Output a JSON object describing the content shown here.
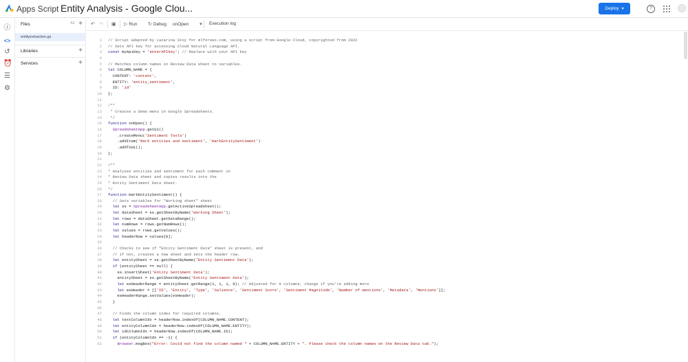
{
  "header": {
    "app_name": "Apps Script",
    "project_title": "Entity Analysis - Google Clou...",
    "deploy_label": "Deploy",
    "colors": {
      "deploy": "#1a73e8"
    }
  },
  "rail": {
    "icons": [
      "info-icon",
      "code-icon",
      "history-icon",
      "triggers-icon",
      "executions-icon",
      "settings-icon"
    ]
  },
  "files_panel": {
    "files_label": "Files",
    "sort_label": "AZ",
    "file_name": "entityextraction.gs",
    "libraries_label": "Libraries",
    "services_label": "Services"
  },
  "toolbar": {
    "run_label": "Run",
    "debug_label": "Debug",
    "function_select": "onOpen",
    "execution_log_label": "Execution log"
  },
  "editor": {
    "lines": [
      "// Script adapted by Lazarina Stoy for mlforseo.com, using a script from Google Cloud, copyrighted from 2022",
      "// Sets API key for accessing Cloud Natural Language API.",
      "const myApiKey = 'enterAPIkey'; // Replace with your API key",
      "",
      "// Matches column names in Review Data sheet to variables.",
      "let COLUMN_NAME = {",
      "  CONTENT: 'content',",
      "  ENTITY: 'entity_sentiment',",
      "  ID: 'id'",
      "};",
      "",
      "/**",
      " * Creates a Demo menu in Google Spreadsheets.",
      " */",
      "function onOpen() {",
      "  SpreadsheetApp.getUi()",
      "    .createMenu('Sentiment Tools')",
      "    .addItem('Mark entities and sentiment', 'markEntitySentiment')",
      "    .addToUi();",
      "};",
      "",
      "/**",
      "* Analyzes entities and sentiment for each comment in",
      "* Review Data sheet and copies results into the",
      "* Entity Sentiment Data sheet.",
      "*/",
      "function markEntitySentiment() {",
      "  // Sets variables for \"Working sheet\" sheet",
      "  let ss = SpreadsheetApp.getActiveSpreadsheet();",
      "  let dataSheet = ss.getSheetByName('Working Sheet');",
      "  let rows = dataSheet.getDataRange();",
      "  let numRows = rows.getNumRows();",
      "  let values = rows.getValues();",
      "  let headerRow = values[0];",
      "",
      "  // Checks to see if \"Entity Sentiment Data\" sheet is present, and",
      "  // if not, creates a new sheet and sets the header row.",
      "  let entitySheet = ss.getSheetByName('Entity Sentiment Data');",
      "  if (entitySheet == null) {",
      "    ss.insertSheet('Entity Sentiment Data');",
      "    entitySheet = ss.getSheetByName('Entity Sentiment Data');",
      "    let esHeaderRange = entitySheet.getRange(1, 1, 1, 9); // Adjusted for 9 columns, change if you're adding more",
      "    let esHeader = [['ID', 'Entity', 'Type', 'Salience', 'Sentiment Score', 'Sentiment Magnitude', 'Number of mentions', 'Metadata', 'Mentions']];",
      "    esHeaderRange.setValues(esHeader);",
      "  }",
      "",
      "  // Finds the column index for required columns.",
      "  let textColumnIdx = headerRow.indexOf(COLUMN_NAME.CONTENT);",
      "  let entityColumnIdx = headerRow.indexOf(COLUMN_NAME.ENTITY);",
      "  let idColumnIdx = headerRow.indexOf(COLUMN_NAME.ID);",
      "  if (entityColumnIdx == -1) {",
      "    Browser.msgBox(\"Error: Could not find the column named \" + COLUMN_NAME.ENTITY + \". Please check the column names on the Review Data tab.\");"
    ]
  }
}
